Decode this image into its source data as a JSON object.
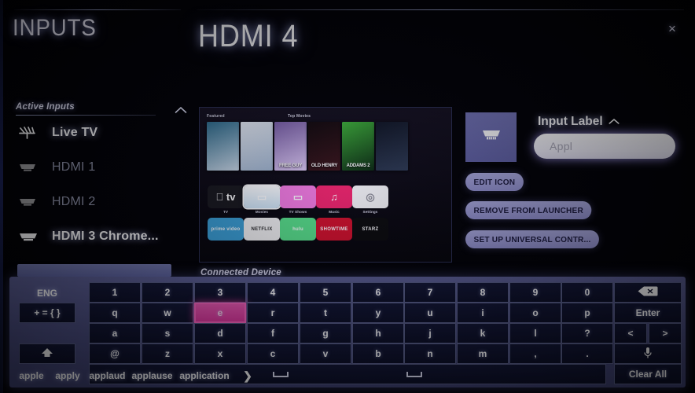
{
  "header": {
    "inputs_title": "INPUTS",
    "selected_input_title": "HDMI 4",
    "close_label": "×"
  },
  "sidebar": {
    "section_label": "Active Inputs",
    "collapse_icon": "chevron-up-icon",
    "items": [
      {
        "label": "Live TV",
        "icon": "antenna-icon",
        "state": "active"
      },
      {
        "label": "HDMI 1",
        "icon": "hdmi-icon",
        "state": "dim"
      },
      {
        "label": "HDMI 2",
        "icon": "hdmi-icon",
        "state": "dim"
      },
      {
        "label": "HDMI 3 Chrome...",
        "icon": "hdmi-icon",
        "state": "active"
      }
    ]
  },
  "preview": {
    "caption": "Connected Device",
    "featured_label": "Featured",
    "top_movies_label": "Top Movies",
    "posters": [
      {
        "title": "",
        "c1": "#2e6f8f",
        "c2": "#c9d8e6"
      },
      {
        "title": "",
        "c1": "#e8eef6",
        "c2": "#9fb4cd"
      },
      {
        "title": "FREE GUY",
        "c1": "#7a5fa8",
        "c2": "#d9c6ee"
      },
      {
        "title": "OLD HENRY",
        "c1": "#120a0c",
        "c2": "#3a1418"
      },
      {
        "title": "ADDAMS 2",
        "c1": "#3fb43a",
        "c2": "#0b2a10"
      },
      {
        "title": "",
        "c1": "#101624",
        "c2": "#2d3a52"
      }
    ],
    "apps_row1": [
      {
        "label": "TV",
        "glyph": " tv",
        "bg": "#18181c",
        "fg": "#ffffff",
        "selected": false
      },
      {
        "label": "Movies",
        "glyph": "▭",
        "bg": "#cfe6f7",
        "fg": "#ffffff",
        "selected": true
      },
      {
        "label": "TV Shows",
        "glyph": "▭",
        "bg": "#f27ae0",
        "fg": "#ffffff",
        "selected": false
      },
      {
        "label": "Music",
        "glyph": "♫",
        "bg": "#f0246b",
        "fg": "#ffffff",
        "selected": false
      },
      {
        "label": "Settings",
        "glyph": "◎",
        "bg": "#f4f4f6",
        "fg": "#8b8b95",
        "selected": false
      }
    ],
    "apps_row2": [
      {
        "label": "prime video",
        "bg": "#3aa0d6",
        "fg": "#ffffff"
      },
      {
        "label": "NETFLIX",
        "bg": "#f3f3f3",
        "fg": "#2b2b2b"
      },
      {
        "label": "hulu",
        "bg": "#57e089",
        "fg": "#ffffff"
      },
      {
        "label": "SHOWTIME",
        "bg": "#d2102a",
        "fg": "#ffffff"
      },
      {
        "label": "STARZ",
        "bg": "#0a0a0a",
        "fg": "#ffffff"
      }
    ]
  },
  "details": {
    "icon_tile_name": "hdmi-icon",
    "input_label_heading": "Input Label",
    "input_label_chevron": "chevron-up-icon",
    "input_value": "Appl",
    "buttons": [
      "EDIT ICON",
      "REMOVE FROM LAUNCHER",
      "SET UP UNIVERSAL CONTR..."
    ]
  },
  "keyboard": {
    "language": "ENG",
    "symbols_key": "+ = { }",
    "shift_key": "shift-icon",
    "selected_key": "e",
    "row_numbers": [
      "1",
      "2",
      "3",
      "4",
      "5",
      "6",
      "7",
      "8",
      "9",
      "0"
    ],
    "row_q": [
      "q",
      "w",
      "e",
      "r",
      "t",
      "y",
      "u",
      "i",
      "o",
      "p"
    ],
    "row_a": [
      "a",
      "s",
      "d",
      "f",
      "g",
      "h",
      "j",
      "k",
      "l",
      "?"
    ],
    "row_z": [
      "@",
      "z",
      "x",
      "c",
      "v",
      "b",
      "n",
      "m",
      ",",
      "."
    ],
    "backspace": "backspace-icon",
    "enter": "Enter",
    "left_arrow": "<",
    "right_arrow": ">",
    "mic": "microphone-icon",
    "clear_all": "Clear All",
    "space": "space-bar",
    "suggestions": [
      "apple",
      "apply",
      "applaud",
      "applause",
      "application"
    ],
    "suggestions_more": "❯"
  },
  "colors": {
    "keyboard_bg": "#4a4d80",
    "key_bg": "#0c0f27",
    "selected_key": "#e0379f",
    "pill_bg": "#9190cd",
    "icon_tile": "#6b6cae",
    "accent_text": "#ffffff"
  }
}
